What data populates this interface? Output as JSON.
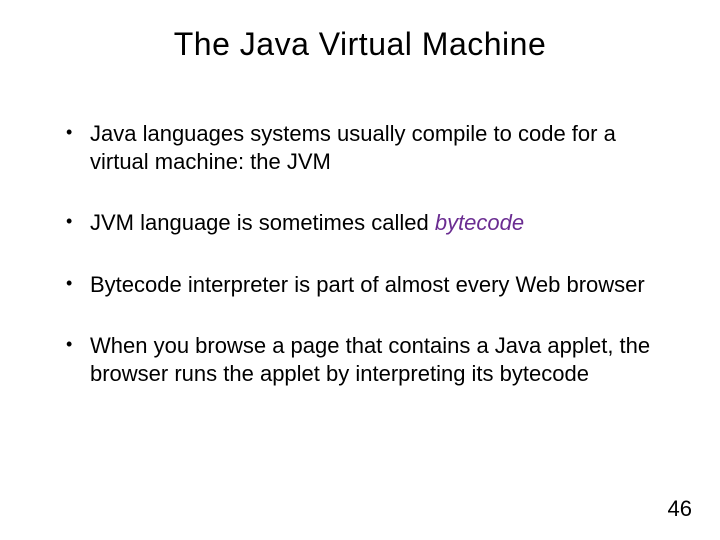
{
  "title": "The Java Virtual Machine",
  "bullets": {
    "b1": "Java languages systems usually compile to code for a virtual machine: the JVM",
    "b2a": "JVM language is sometimes called ",
    "b2b": "bytecode",
    "b3": "Bytecode interpreter is part of almost every Web browser",
    "b4": "When you browse a page that contains a Java applet, the browser runs the applet by interpreting its bytecode"
  },
  "page_number": "46"
}
